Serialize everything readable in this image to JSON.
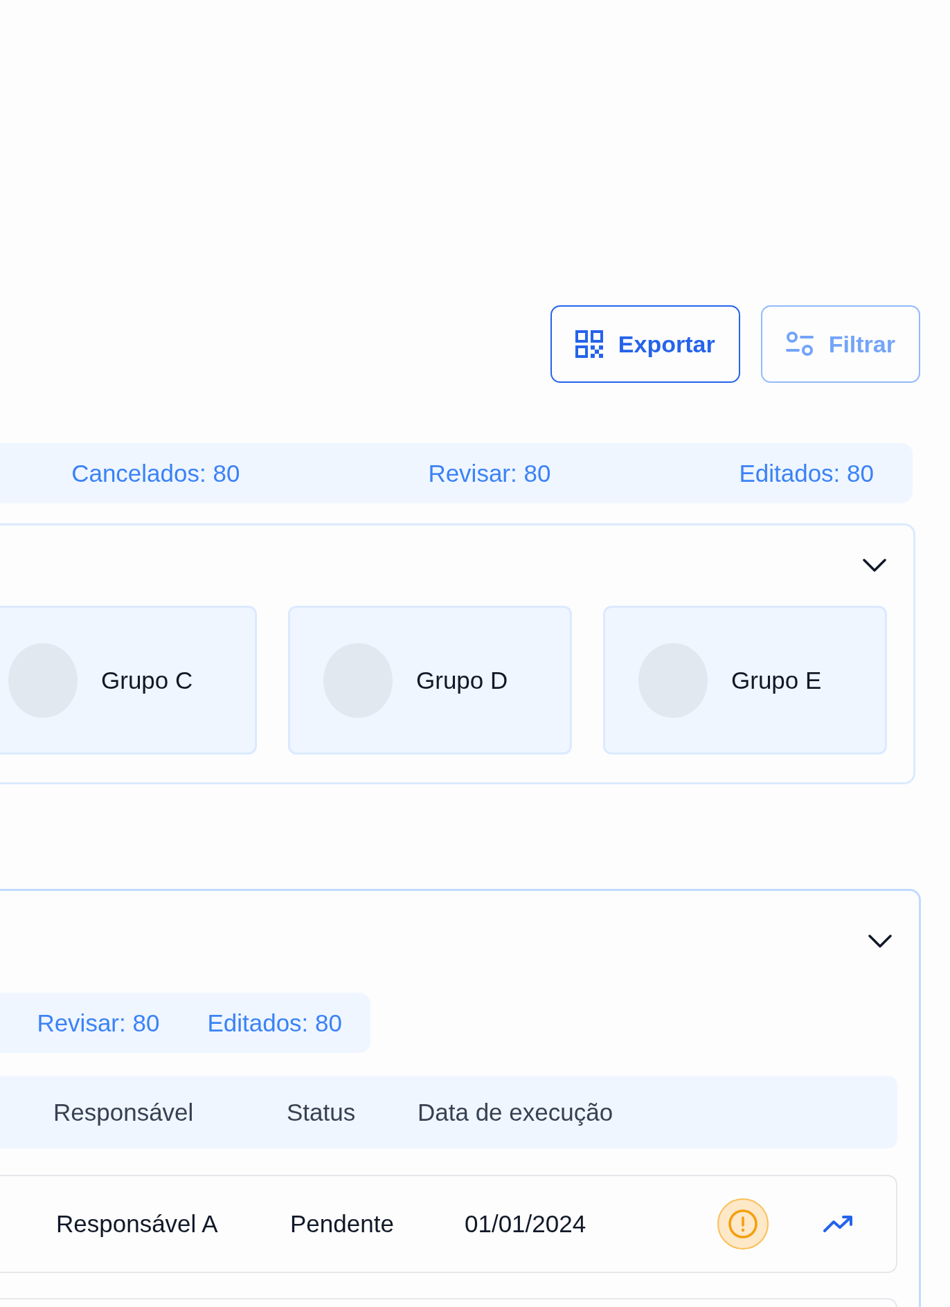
{
  "toolbar": {
    "buttons": [
      {
        "label": "Exportar",
        "kind": "export",
        "disabled": false
      },
      {
        "label": "Filtrar",
        "kind": "filter",
        "disabled": true
      }
    ]
  },
  "summary": {
    "stats": [
      "Cancelados: 80",
      "Revisar: 80",
      "Editados: 80"
    ]
  },
  "groups": {
    "items": [
      {
        "name": "Grupo C"
      },
      {
        "name": "Grupo D"
      },
      {
        "name": "Grupo E"
      }
    ]
  },
  "tasks": {
    "stats": [
      "Revisar: 80",
      "Editados: 80"
    ],
    "table": {
      "columns": [
        "Responsável",
        "Status",
        "Data de execução"
      ],
      "rows": [
        {
          "cells": [
            "Responsável A",
            "Pendente",
            "01/01/2024"
          ],
          "warning": true
        }
      ]
    }
  }
}
